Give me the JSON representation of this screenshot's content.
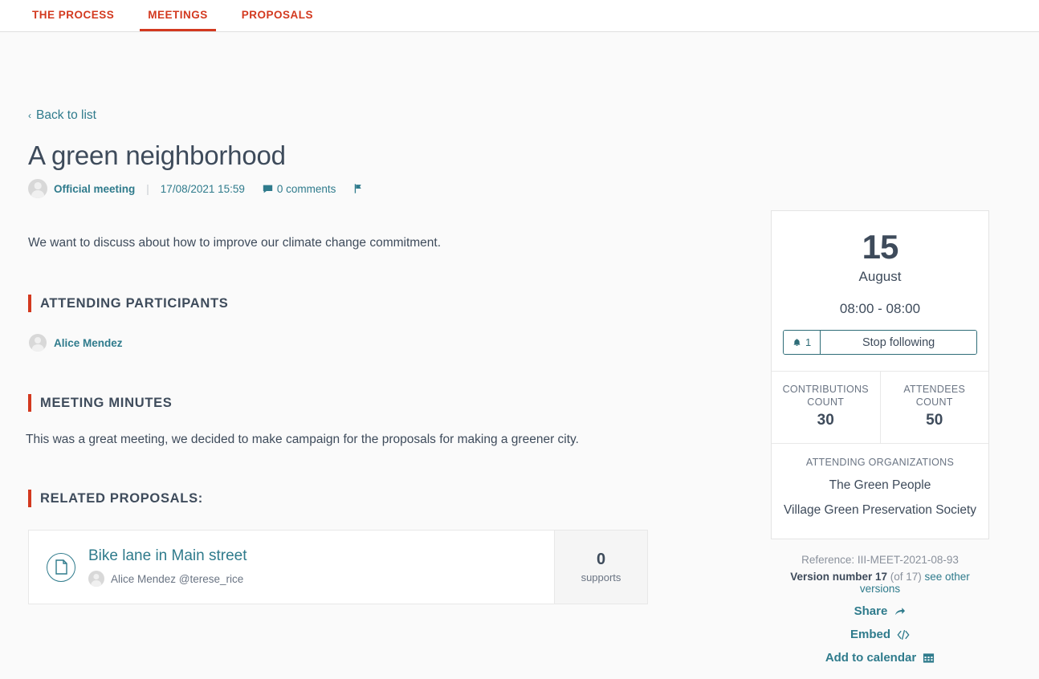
{
  "nav": {
    "tabs": [
      {
        "label": "THE PROCESS",
        "active": false
      },
      {
        "label": "MEETINGS",
        "active": true
      },
      {
        "label": "PROPOSALS",
        "active": false
      }
    ]
  },
  "back_link": {
    "label": "Back to list",
    "chevron": "‹"
  },
  "meeting": {
    "title": "A green neighborhood",
    "author": "Official meeting",
    "date": "17/08/2021 15:59",
    "comments": "0 comments",
    "separator": "|",
    "description": "We want to discuss about how to improve our climate change commitment."
  },
  "sections": {
    "participants": {
      "heading": "ATTENDING PARTICIPANTS",
      "people": [
        {
          "name": "Alice Mendez"
        }
      ]
    },
    "minutes": {
      "heading": "MEETING MINUTES",
      "text": "This was a great meeting, we decided to make campaign for the proposals for making a greener city."
    },
    "related": {
      "heading": "RELATED PROPOSALS:",
      "proposals": [
        {
          "title": "Bike lane in Main street",
          "author": "Alice Mendez @terese_rice",
          "supports_count": "0",
          "supports_label": "supports"
        }
      ]
    }
  },
  "sidebar": {
    "date": {
      "day": "15",
      "month": "August",
      "time_range": "08:00 - 08:00"
    },
    "follow": {
      "count": "1",
      "button_label": "Stop following"
    },
    "stats": [
      {
        "label": "CONTRIBUTIONS COUNT",
        "value": "30"
      },
      {
        "label": "ATTENDEES COUNT",
        "value": "50"
      }
    ],
    "organizations": {
      "label": "ATTENDING ORGANIZATIONS",
      "items": [
        "The Green People",
        "Village Green Preservation Society"
      ]
    },
    "reference": "Reference: III-MEET-2021-08-93",
    "version": {
      "bold": "Version number 17",
      "of": " (of 17) ",
      "link": "see other versions"
    },
    "actions": [
      {
        "label": "Share",
        "icon": "share-arrow-icon"
      },
      {
        "label": "Embed",
        "icon": "code-icon"
      },
      {
        "label": "Add to calendar",
        "icon": "calendar-icon"
      }
    ]
  },
  "colors": {
    "accent_red": "#d3391f",
    "link_teal": "#2f7b8c",
    "text_dark": "#3e4b5b",
    "muted": "#8a919c",
    "page_bg": "#fafafa"
  }
}
